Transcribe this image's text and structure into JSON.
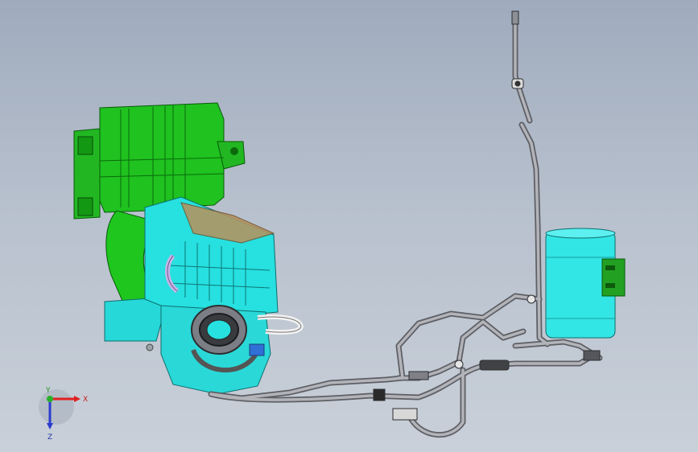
{
  "triad": {
    "x_label": "X",
    "y_label": "Y",
    "z_label": "Z"
  },
  "colors": {
    "background_top": "#9fabbd",
    "background_bottom": "#c9d0d9",
    "airbox_green": "#1fc21f",
    "engine_cyan": "#27e0e0",
    "pipe_grey": "#8e9096",
    "canister_cyan": "#33e6e6",
    "bracket_brown": "#b9915b",
    "triad_x": "#e0201f",
    "triad_y": "#29b029",
    "triad_z": "#2a3ccf"
  }
}
